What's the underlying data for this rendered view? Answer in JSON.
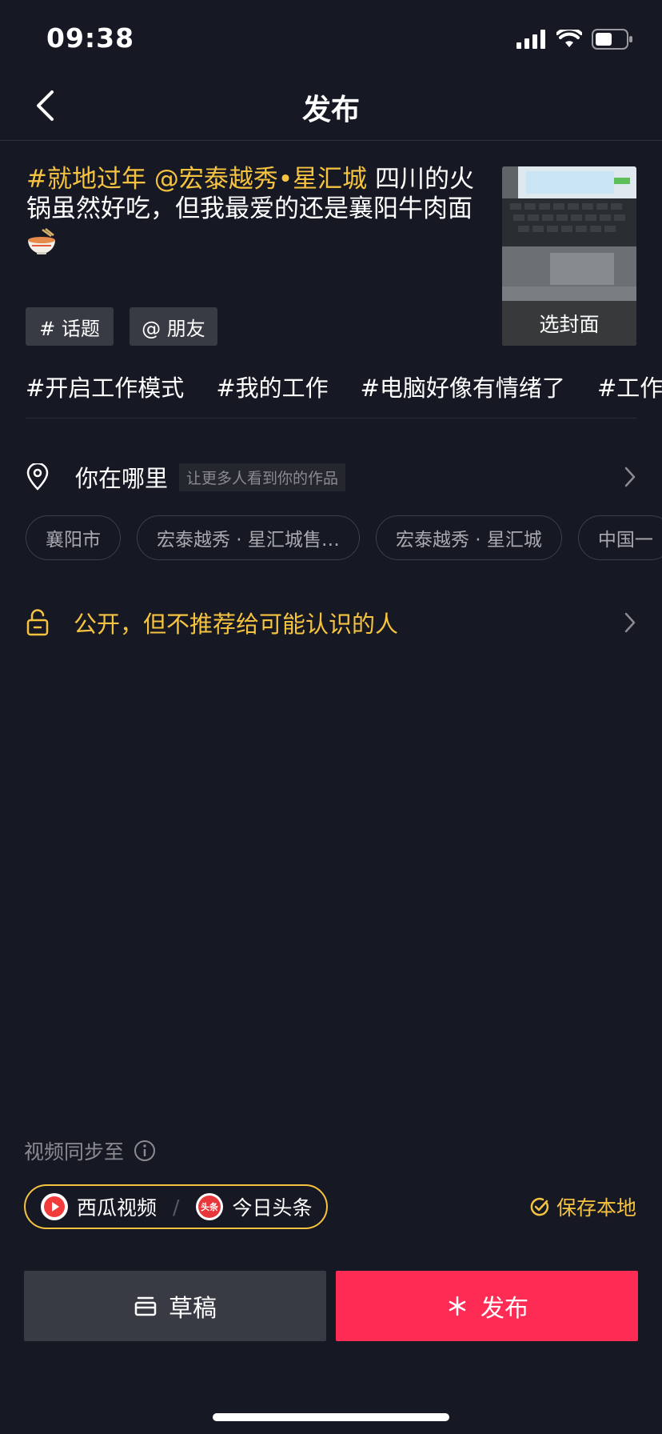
{
  "status_bar": {
    "time": "09:38"
  },
  "header": {
    "title": "发布"
  },
  "caption": {
    "highlight": "#就地过年 @宏泰越秀•星汇城",
    "text": " 四川的火锅虽然好吃，但我最爱的还是襄阳牛肉面",
    "emoji_icon": "noodle-bowl-icon"
  },
  "cover": {
    "label": "选封面"
  },
  "chips": {
    "topic": "# 话题",
    "friend": "@ 朋友"
  },
  "hashtags": [
    "#开启工作模式",
    "#我的工作",
    "#电脑好像有情绪了",
    "#工作"
  ],
  "location": {
    "title": "你在哪里",
    "hint": "让更多人看到你的作品",
    "places": [
      "襄阳市",
      "宏泰越秀 · 星汇城售…",
      "宏泰越秀 · 星汇城",
      "中国一"
    ]
  },
  "privacy": {
    "text": "公开，但不推荐给可能认识的人"
  },
  "sync": {
    "label": "视频同步至",
    "xigua": "西瓜视频",
    "toutiao": "今日头条",
    "toutiao_logo_text": "头条",
    "separator": "/",
    "save_local": "保存本地"
  },
  "buttons": {
    "draft": "草稿",
    "publish": "发布"
  },
  "colors": {
    "background": "#161823",
    "accent_yellow": "#f6c340",
    "publish_red": "#fe2c55",
    "chip_gray": "#393b44"
  }
}
